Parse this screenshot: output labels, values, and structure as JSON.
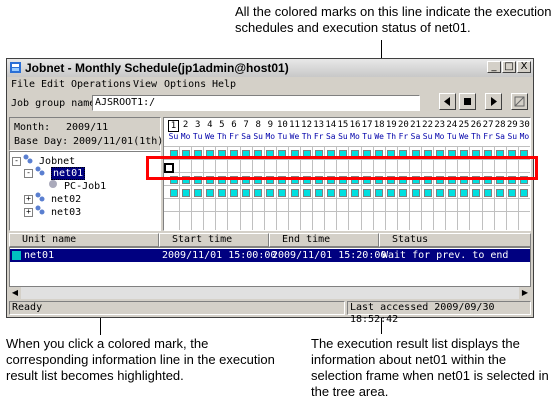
{
  "callouts": {
    "top": "All the colored marks on this line indicate the execution schedules and execution status of net01.",
    "bottom_left": "When you click a colored mark, the corresponding information line in the execution result list becomes highlighted.",
    "bottom_right": "The execution result list displays the information about net01 within the selection frame when net01 is selected in the tree area."
  },
  "window": {
    "title": "Jobnet - Monthly Schedule(jp1admin@host01)",
    "controls": [
      "_",
      "□",
      "X"
    ]
  },
  "menu": [
    "File",
    "Edit",
    "Operations",
    "View",
    "Options",
    "Help"
  ],
  "job_group": {
    "label": "Job group name:",
    "value": "AJSROOT1:/"
  },
  "nav_buttons": [
    "previous-icon",
    "stop-icon",
    "next-icon",
    "settings-icon"
  ],
  "info": {
    "month_label": "Month:",
    "month_value": "2009/11",
    "baseday_label": "Base Day:",
    "baseday_value": "2009/11/01(1th)"
  },
  "tree": [
    {
      "label": "Jobnet",
      "icon": "jobnet-icon",
      "toggle": "-"
    },
    {
      "label": "net01",
      "icon": "jobnet-icon",
      "toggle": "-",
      "selected": true
    },
    {
      "label": "PC-Job1",
      "icon": "job-icon",
      "toggle": ""
    },
    {
      "label": "net02",
      "icon": "jobnet-icon",
      "toggle": "+"
    },
    {
      "label": "net03",
      "icon": "jobnet-icon",
      "toggle": "+"
    }
  ],
  "calendar": {
    "days": [
      "1",
      "2",
      "3",
      "4",
      "5",
      "6",
      "7",
      "8",
      "9",
      "10",
      "11",
      "12",
      "13",
      "14",
      "15",
      "16",
      "17",
      "18",
      "19",
      "20",
      "21",
      "22",
      "23",
      "24",
      "25",
      "26",
      "27",
      "28",
      "29",
      "30"
    ],
    "weekdays": [
      "Su",
      "Mo",
      "Tu",
      "We",
      "Th",
      "Fr",
      "Sa",
      "Su",
      "Mo",
      "Tu",
      "We",
      "Th",
      "Fr",
      "Sa",
      "Su",
      "Mo",
      "Tu",
      "We",
      "Th",
      "Fr",
      "Sa",
      "Su",
      "Mo",
      "Tu",
      "We",
      "Th",
      "Fr",
      "Sa",
      "Su",
      "Mo"
    ],
    "mark_color": "#00e0e0",
    "rows_with_marks": [
      1,
      3,
      4
    ],
    "selected_day": "1"
  },
  "results": {
    "columns": [
      "Unit name",
      "Start time",
      "End time",
      "Status"
    ],
    "rows": [
      {
        "unit": "net01",
        "start": "2009/11/01 15:00:00",
        "end": "2009/11/01 15:20:00",
        "status": "Wait for prev. to end"
      }
    ]
  },
  "status": {
    "left": "Ready",
    "right": "Last accessed 2009/09/30 18:52:42"
  },
  "colors": {
    "highlight_frame": "#ff0000",
    "selection": "#000080"
  }
}
